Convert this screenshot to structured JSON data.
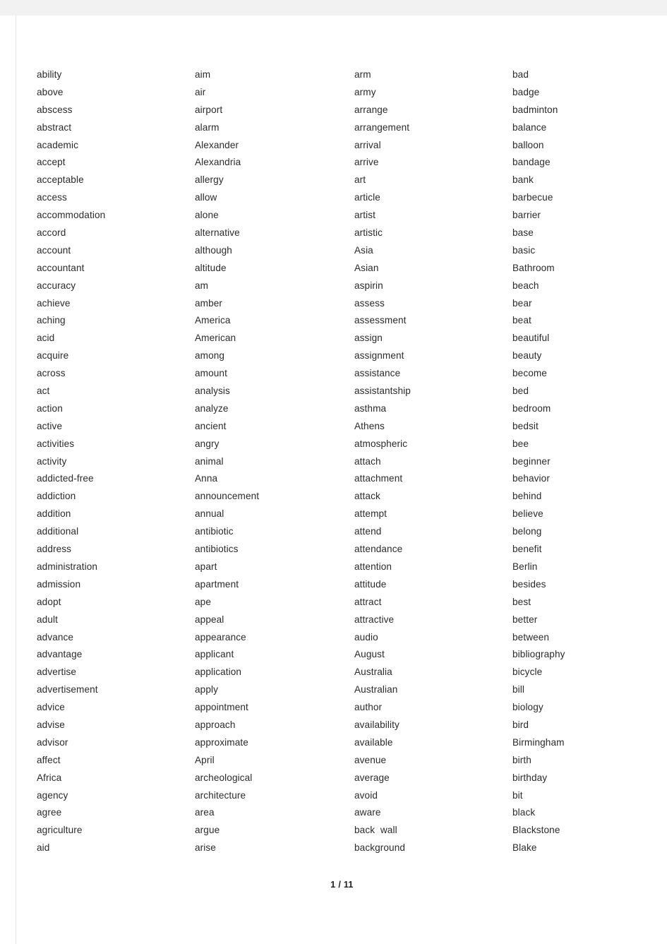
{
  "document": {
    "page_indicator": "1 / 11",
    "columns": [
      {
        "name": "column-1",
        "words": [
          "ability",
          "above",
          "abscess",
          "abstract",
          "academic",
          "accept",
          "acceptable",
          "access",
          "accommodation",
          "accord",
          "account",
          "accountant",
          "accuracy",
          "achieve",
          "aching",
          "acid",
          "acquire",
          "across",
          "act",
          "action",
          "active",
          "activities",
          "activity",
          "addicted-free",
          "addiction",
          "addition",
          "additional",
          "address",
          "administration",
          "admission",
          "adopt",
          "adult",
          "advance",
          "advantage",
          "advertise",
          "advertisement",
          "advice",
          "advise",
          "advisor",
          "affect",
          "Africa",
          "agency",
          "agree",
          "agriculture",
          "aid"
        ]
      },
      {
        "name": "column-2",
        "words": [
          "aim",
          "air",
          "airport",
          "alarm",
          "Alexander",
          "Alexandria",
          "allergy",
          "allow",
          "alone",
          "alternative",
          "although",
          "altitude",
          "am",
          "amber",
          "America",
          "American",
          "among",
          "amount",
          "analysis",
          "analyze",
          "ancient",
          "angry",
          "animal",
          "Anna",
          "announcement",
          "annual",
          "antibiotic",
          "antibiotics",
          "apart",
          "apartment",
          "ape",
          "appeal",
          "appearance",
          "applicant",
          "application",
          "apply",
          "appointment",
          "approach",
          "approximate",
          "April",
          "archeological",
          "architecture",
          "area",
          "argue",
          "arise"
        ]
      },
      {
        "name": "column-3",
        "words": [
          "arm",
          "army",
          "arrange",
          "arrangement",
          "arrival",
          "arrive",
          "art",
          "article",
          "artist",
          "artistic",
          "Asia",
          "Asian",
          "aspirin",
          "assess",
          "assessment",
          "assign",
          "assignment",
          "assistance",
          "assistantship",
          "asthma",
          "Athens",
          "atmospheric",
          "attach",
          "attachment",
          "attack",
          "attempt",
          "attend",
          "attendance",
          "attention",
          "attitude",
          "attract",
          "attractive",
          "audio",
          "August",
          "Australia",
          "Australian",
          "author",
          "availability",
          "available",
          "avenue",
          "average",
          "avoid",
          "aware",
          "back  wall",
          "background"
        ]
      },
      {
        "name": "column-4",
        "words": [
          "bad",
          "badge",
          "badminton",
          "balance",
          "balloon",
          "bandage",
          "bank",
          "barbecue",
          "barrier",
          "base",
          "basic",
          "Bathroom",
          "beach",
          "bear",
          "beat",
          "beautiful",
          "beauty",
          "become",
          "bed",
          "bedroom",
          "bedsit",
          "bee",
          "beginner",
          "behavior",
          "behind",
          "believe",
          "belong",
          "benefit",
          "Berlin",
          "besides",
          "best",
          "better",
          "between",
          "bibliography",
          "bicycle",
          "bill",
          "biology",
          "bird",
          "Birmingham",
          "birth",
          "birthday",
          "bit",
          "black",
          "Blackstone",
          "Blake"
        ]
      }
    ]
  },
  "colors": {
    "page_background": "#ffffff",
    "chrome_background": "#f2f2f2",
    "text": "#2b2b2b",
    "border": "#e3e3e3"
  }
}
